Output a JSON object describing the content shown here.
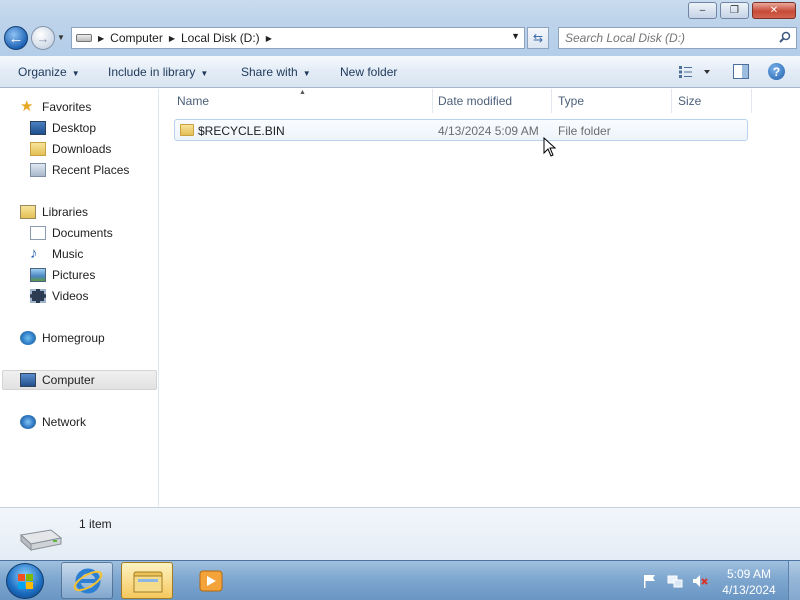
{
  "window": {
    "controls": {
      "minimize": "–",
      "maximize": "❐",
      "close": "✕"
    }
  },
  "address": {
    "crumbs": [
      "Computer",
      "Local Disk (D:)"
    ],
    "search_placeholder": "Search Local Disk (D:)"
  },
  "toolbar": {
    "organize": "Organize",
    "include_in_library": "Include in library",
    "share_with": "Share with",
    "new_folder": "New folder",
    "help": "?"
  },
  "sidebar": {
    "favorites": {
      "label": "Favorites",
      "items": [
        "Desktop",
        "Downloads",
        "Recent Places"
      ]
    },
    "libraries": {
      "label": "Libraries",
      "items": [
        "Documents",
        "Music",
        "Pictures",
        "Videos"
      ]
    },
    "homegroup": "Homegroup",
    "computer": "Computer",
    "network": "Network"
  },
  "file_list": {
    "columns": [
      "Name",
      "Date modified",
      "Type",
      "Size"
    ],
    "rows": [
      {
        "name": "$RECYCLE.BIN",
        "date_modified": "4/13/2024 5:09 AM",
        "type": "File folder",
        "size": ""
      }
    ]
  },
  "details": {
    "item_count": "1 item"
  },
  "taskbar": {
    "clock_time": "5:09 AM",
    "clock_date": "4/13/2024"
  },
  "colors": {
    "accent": "#1c5ea9",
    "selection_border": "#b8d1ee",
    "taskbar": "#7fa7cf"
  }
}
